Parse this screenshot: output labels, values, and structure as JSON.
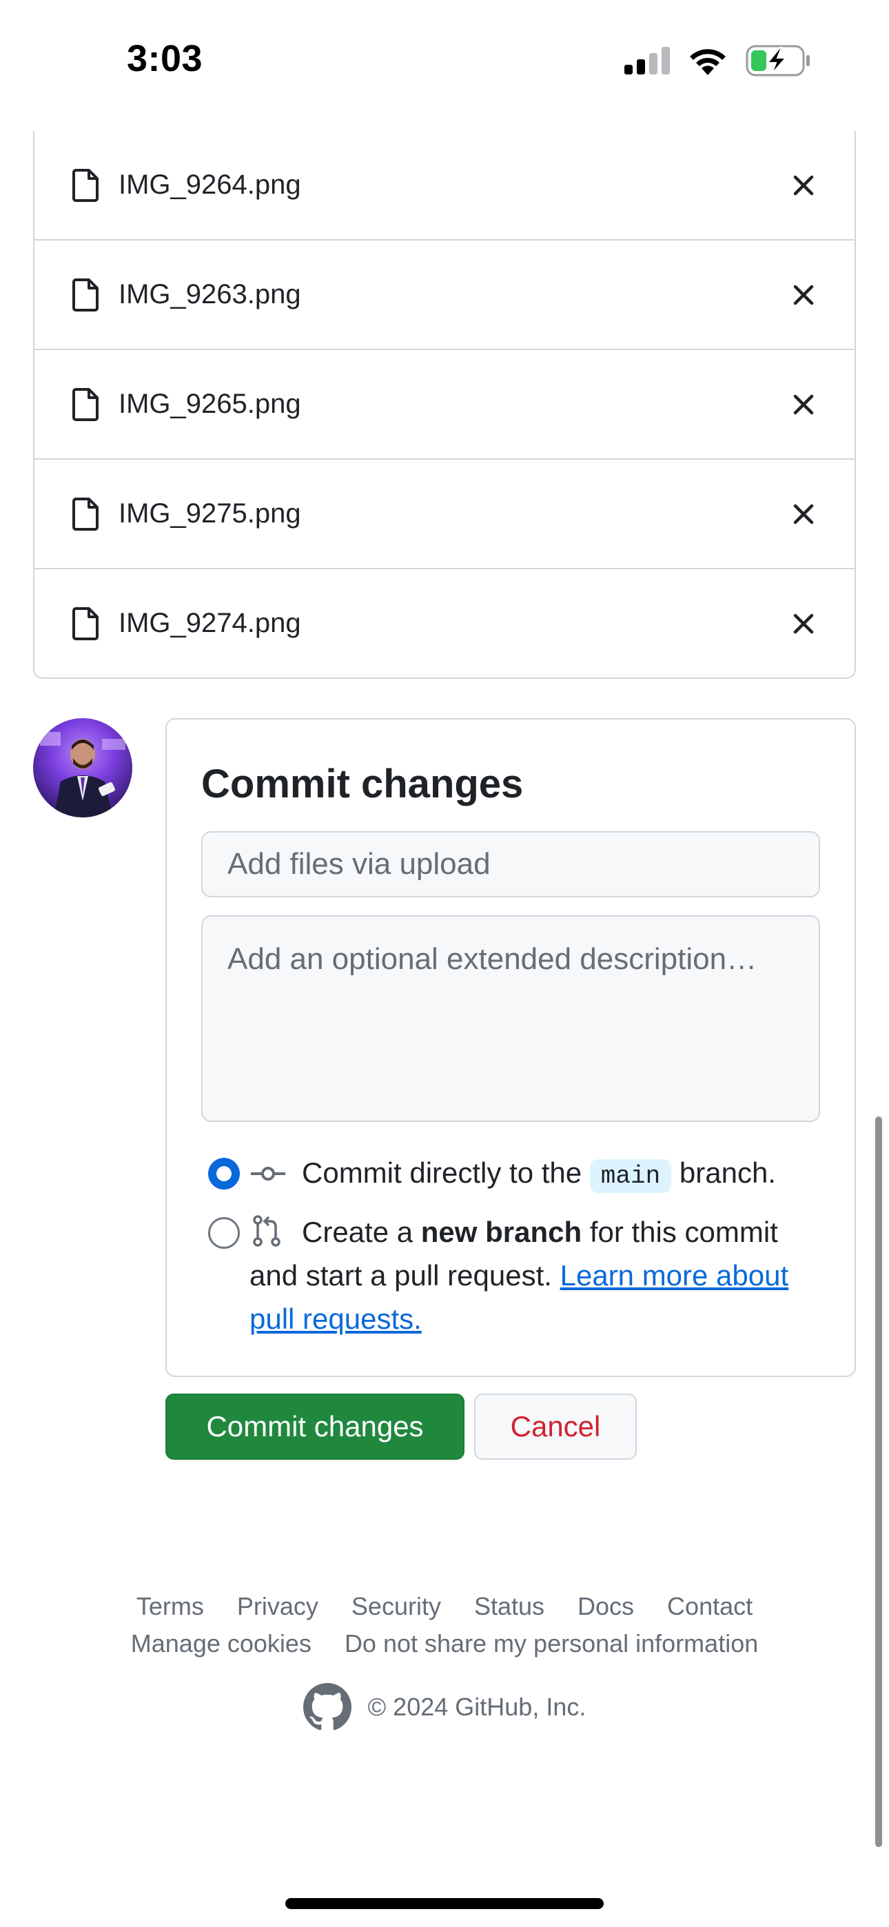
{
  "status_bar": {
    "time": "3:03",
    "icons": [
      "cellular-signal-icon",
      "wifi-icon",
      "battery-charging-icon"
    ]
  },
  "files": [
    {
      "name": "IMG_9264.png",
      "icon": "file-icon",
      "remove_icon": "close-icon"
    },
    {
      "name": "IMG_9263.png",
      "icon": "file-icon",
      "remove_icon": "close-icon"
    },
    {
      "name": "IMG_9265.png",
      "icon": "file-icon",
      "remove_icon": "close-icon"
    },
    {
      "name": "IMG_9275.png",
      "icon": "file-icon",
      "remove_icon": "close-icon"
    },
    {
      "name": "IMG_9274.png",
      "icon": "file-icon",
      "remove_icon": "close-icon"
    }
  ],
  "commit": {
    "title": "Commit changes",
    "summary_placeholder": "Add files via upload",
    "description_placeholder": "Add an optional extended description…",
    "option_direct": {
      "selected": true,
      "prefix": "Commit directly to the",
      "branch": "main",
      "suffix": "branch.",
      "icon": "git-commit-icon"
    },
    "option_new_branch": {
      "selected": false,
      "prefix": "Create a",
      "bold": "new branch",
      "suffix": "for this commit and start a pull request.",
      "link": "Learn more about pull requests.",
      "icon": "git-pull-request-icon"
    }
  },
  "buttons": {
    "commit_label": "Commit changes",
    "cancel_label": "Cancel"
  },
  "footer": {
    "links_row1": [
      "Terms",
      "Privacy",
      "Security",
      "Status",
      "Docs",
      "Contact"
    ],
    "links_row2": [
      "Manage cookies",
      "Do not share my personal information"
    ],
    "copyright": "© 2024 GitHub, Inc.",
    "logo_icon": "github-logo-icon"
  },
  "colors": {
    "accent_blue": "#0969da",
    "commit_green": "#1f883d",
    "cancel_red": "#cf222e",
    "border": "#d0d7de",
    "muted_text": "#656d76"
  }
}
